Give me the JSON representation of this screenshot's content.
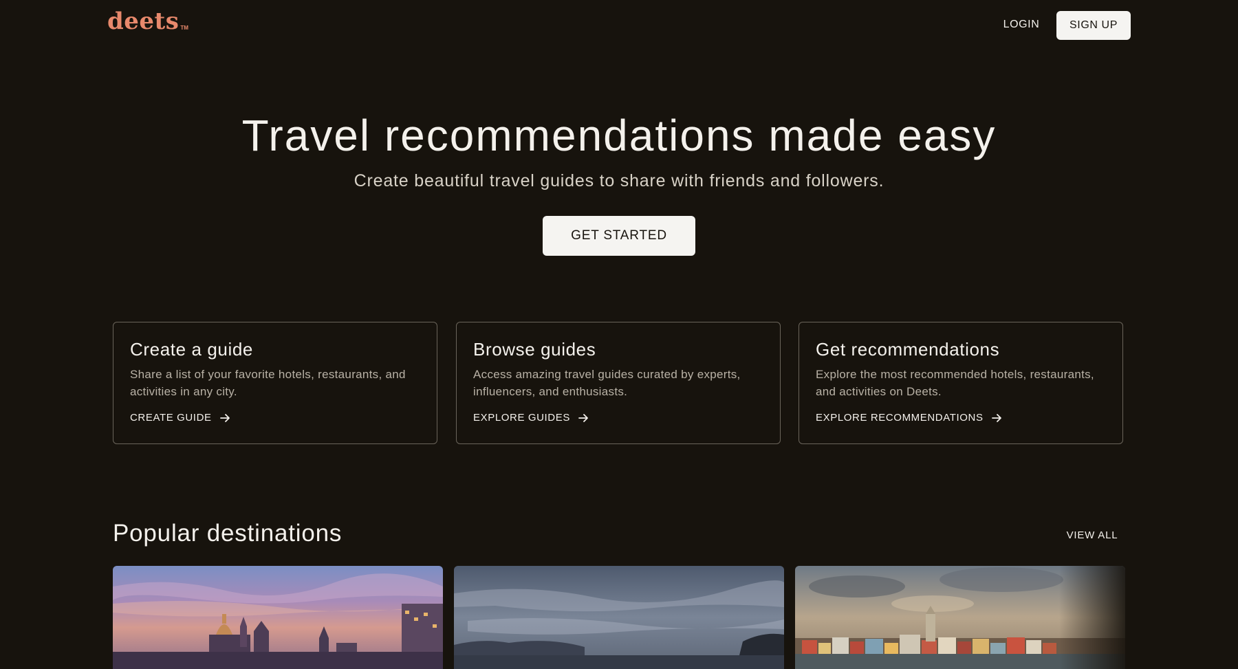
{
  "header": {
    "logo_text": "deets",
    "logo_tm": "TM",
    "login_label": "LOGIN",
    "signup_label": "SIGN UP"
  },
  "hero": {
    "title": "Travel recommendations made easy",
    "subtitle": "Create beautiful travel guides to share with friends and followers.",
    "cta_label": "GET STARTED"
  },
  "features": [
    {
      "title": "Create a guide",
      "description": "Share a list of your favorite hotels, restaurants, and activities in any city.",
      "link_label": "CREATE GUIDE"
    },
    {
      "title": "Browse guides",
      "description": "Access amazing travel guides curated by experts, influencers, and enthusiasts.",
      "link_label": "EXPLORE GUIDES"
    },
    {
      "title": "Get recommendations",
      "description": "Explore the most recommended hotels, restaurants, and activities on Deets.",
      "link_label": "EXPLORE RECOMMENDATIONS"
    }
  ],
  "popular": {
    "title": "Popular destinations",
    "view_all_label": "VIEW ALL"
  },
  "icons": {
    "arrow": "arrow-right-icon"
  },
  "colors": {
    "background": "#17130d",
    "brand": "#e8896c",
    "button_bg": "#f5f4f1",
    "card_border": "#6b655b"
  }
}
